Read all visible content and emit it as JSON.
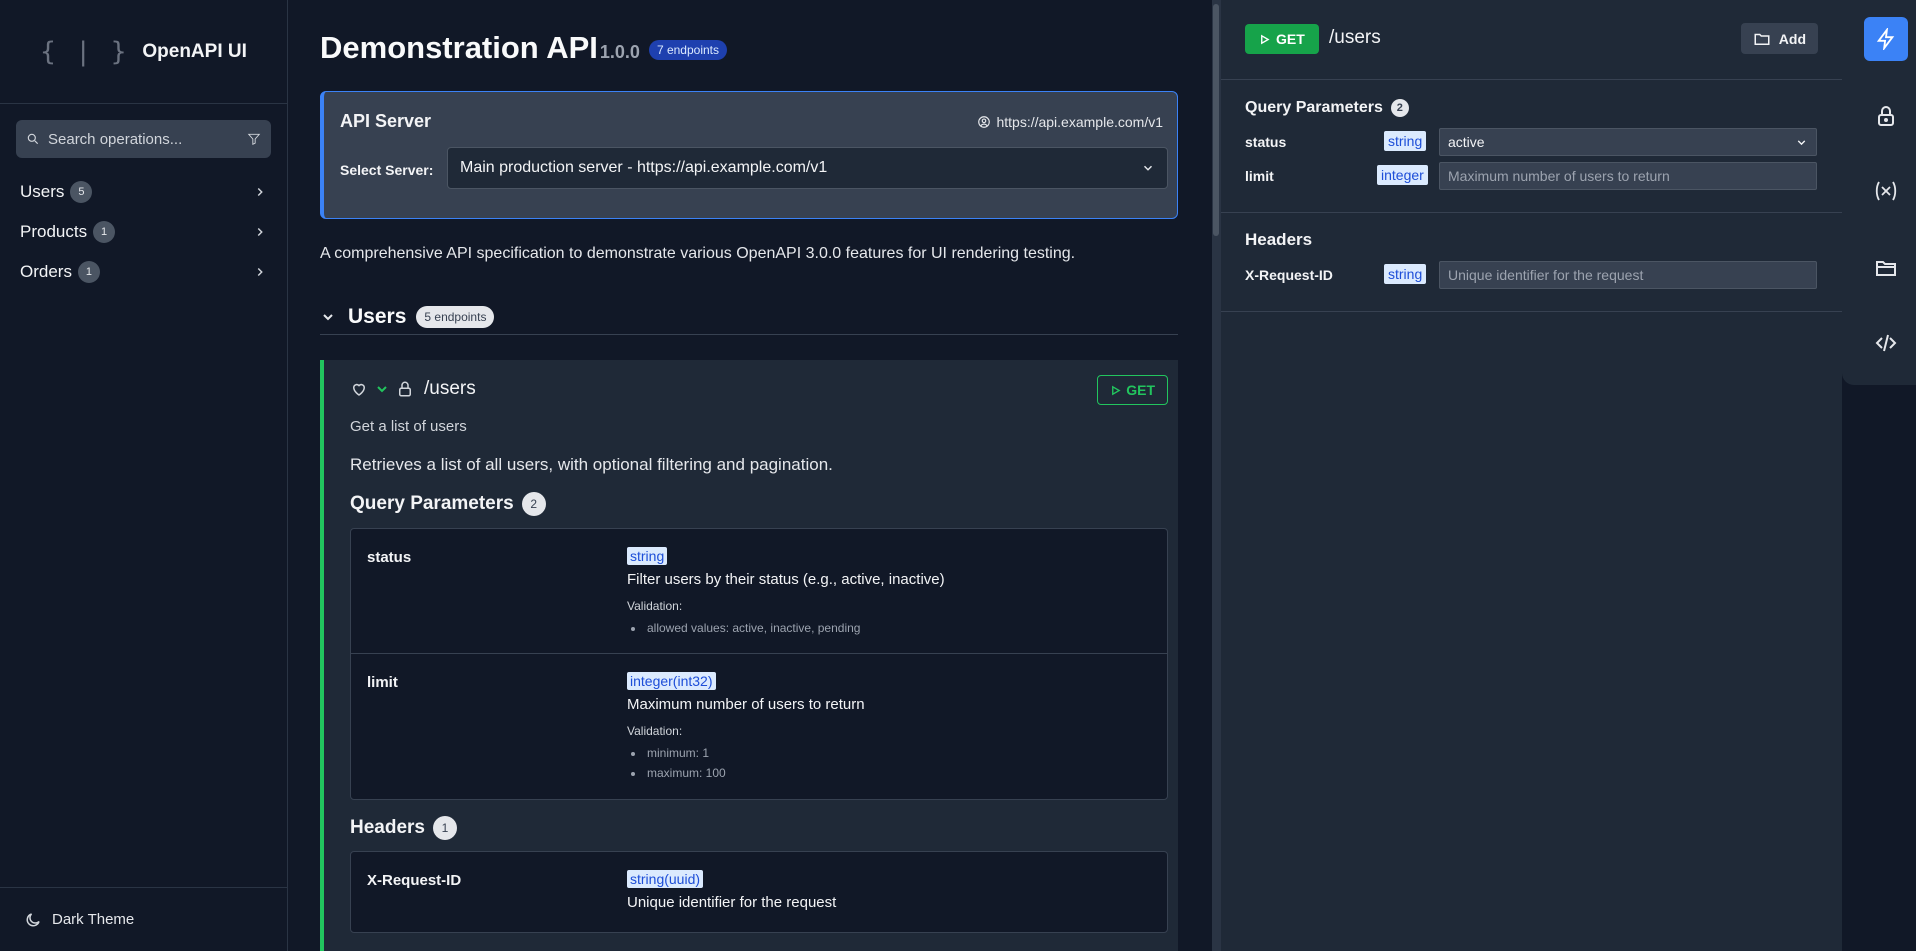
{
  "sidebar": {
    "logo_icon": "{ | }",
    "app_name": "OpenAPI UI",
    "search_placeholder": "Search operations...",
    "items": [
      {
        "label": "Users",
        "count": "5"
      },
      {
        "label": "Products",
        "count": "1"
      },
      {
        "label": "Orders",
        "count": "1"
      }
    ],
    "theme_label": "Dark Theme"
  },
  "header": {
    "title": "Demonstration API",
    "version": "1.0.0",
    "endpoints_badge": "7 endpoints"
  },
  "server": {
    "title": "API Server",
    "url": "https://api.example.com/v1",
    "select_label": "Select Server:",
    "selected": "Main production server - https://api.example.com/v1"
  },
  "description": "A comprehensive API specification to demonstrate various OpenAPI 3.0.0 features for UI rendering testing.",
  "section": {
    "title": "Users",
    "badge": "5 endpoints"
  },
  "operation": {
    "path": "/users",
    "method": "GET",
    "summary": "Get a list of users",
    "description": "Retrieves a list of all users, with optional filtering and pagination.",
    "query_title": "Query Parameters",
    "query_count": "2",
    "params": [
      {
        "name": "status",
        "type": "string",
        "desc": "Filter users by their status (e.g., active, inactive)",
        "validation": "Validation:",
        "rules": [
          "allowed values: active, inactive, pending"
        ]
      },
      {
        "name": "limit",
        "type": "integer(int32)",
        "desc": "Maximum number of users to return",
        "validation": "Validation:",
        "rules": [
          "minimum: 1",
          "maximum: 100"
        ]
      }
    ],
    "headers_title": "Headers",
    "headers_count": "1",
    "headers": [
      {
        "name": "X-Request-ID",
        "type": "string(uuid)",
        "desc": "Unique identifier for the request"
      }
    ]
  },
  "panel": {
    "method": "GET",
    "path": "/users",
    "add_label": "Add",
    "query_title": "Query Parameters",
    "query_count": "2",
    "params": [
      {
        "name": "status",
        "type": "string",
        "value": "active"
      },
      {
        "name": "limit",
        "type": "integer",
        "placeholder": "Maximum number of users to return"
      }
    ],
    "headers_title": "Headers",
    "headers": [
      {
        "name": "X-Request-ID",
        "type": "string",
        "placeholder": "Unique identifier for the request"
      }
    ]
  },
  "rail": [
    "lightning-icon",
    "lock-icon",
    "variable-icon",
    "folder-icon",
    "code-icon"
  ],
  "colors": {
    "accent": "#3b82f6",
    "get": "#22c55e",
    "background": "#111827",
    "panel": "#1f2937"
  }
}
